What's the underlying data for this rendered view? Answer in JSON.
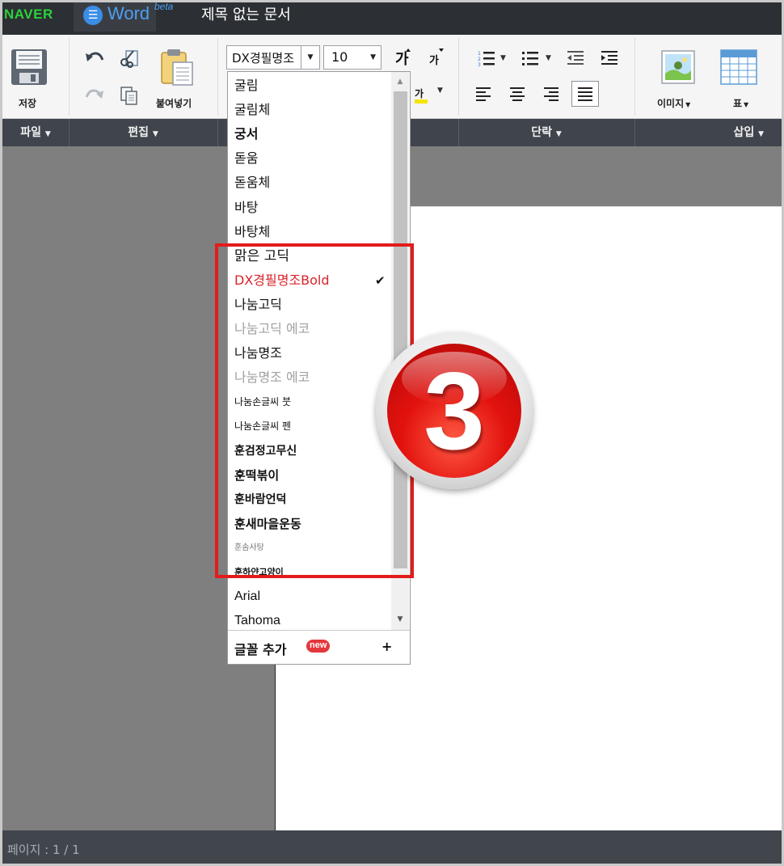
{
  "topbar": {
    "logo": "NAVER",
    "app_name": "Word",
    "app_badge": "beta",
    "doc_title": "제목 없는 문서"
  },
  "ribbon": {
    "file": {
      "save_label": "저장"
    },
    "edit": {
      "paste_label": "붙여넣기"
    },
    "font": {
      "font_name": "DX경필명조",
      "font_size": "10"
    },
    "insert": {
      "image_label": "이미지",
      "table_label": "표"
    }
  },
  "categories": [
    "파일",
    "편집",
    "단락",
    "삽입"
  ],
  "font_menu": {
    "items": [
      {
        "label": "굴림"
      },
      {
        "label": "굴림체"
      },
      {
        "label": "궁서"
      },
      {
        "label": "돋움"
      },
      {
        "label": "돋움체"
      },
      {
        "label": "바탕"
      },
      {
        "label": "바탕체"
      },
      {
        "label": "맑은 고딕"
      },
      {
        "label": "DX경필명조Bold",
        "selected": true
      },
      {
        "label": "나눔고딕"
      },
      {
        "label": "나눔고딕 에코"
      },
      {
        "label": "나눔명조"
      },
      {
        "label": "나눔명조 에코"
      },
      {
        "label": "나눔손글씨 붓"
      },
      {
        "label": "나눔손글씨 펜"
      },
      {
        "label": "훈검정고무신"
      },
      {
        "label": "훈떡볶이"
      },
      {
        "label": "훈바람언덕"
      },
      {
        "label": "훈새마을운동"
      },
      {
        "label": "훈솜사탕"
      },
      {
        "label": "훈하얀고양이"
      },
      {
        "label": "Arial"
      },
      {
        "label": "Tahoma"
      }
    ],
    "add_font_label": "글꼴 추가",
    "new_badge": "new",
    "plus_symbol": "+"
  },
  "step_badge": "3",
  "status": {
    "page_text": "페이지 : 1 / 1"
  },
  "colors": {
    "topbar_bg": "#2c2f33",
    "logo": "#2bd23a",
    "selected_font": "#d9232a",
    "highlight_border": "#e31b1b",
    "category_bar": "#40454d",
    "workspace": "#7f7f7f"
  }
}
